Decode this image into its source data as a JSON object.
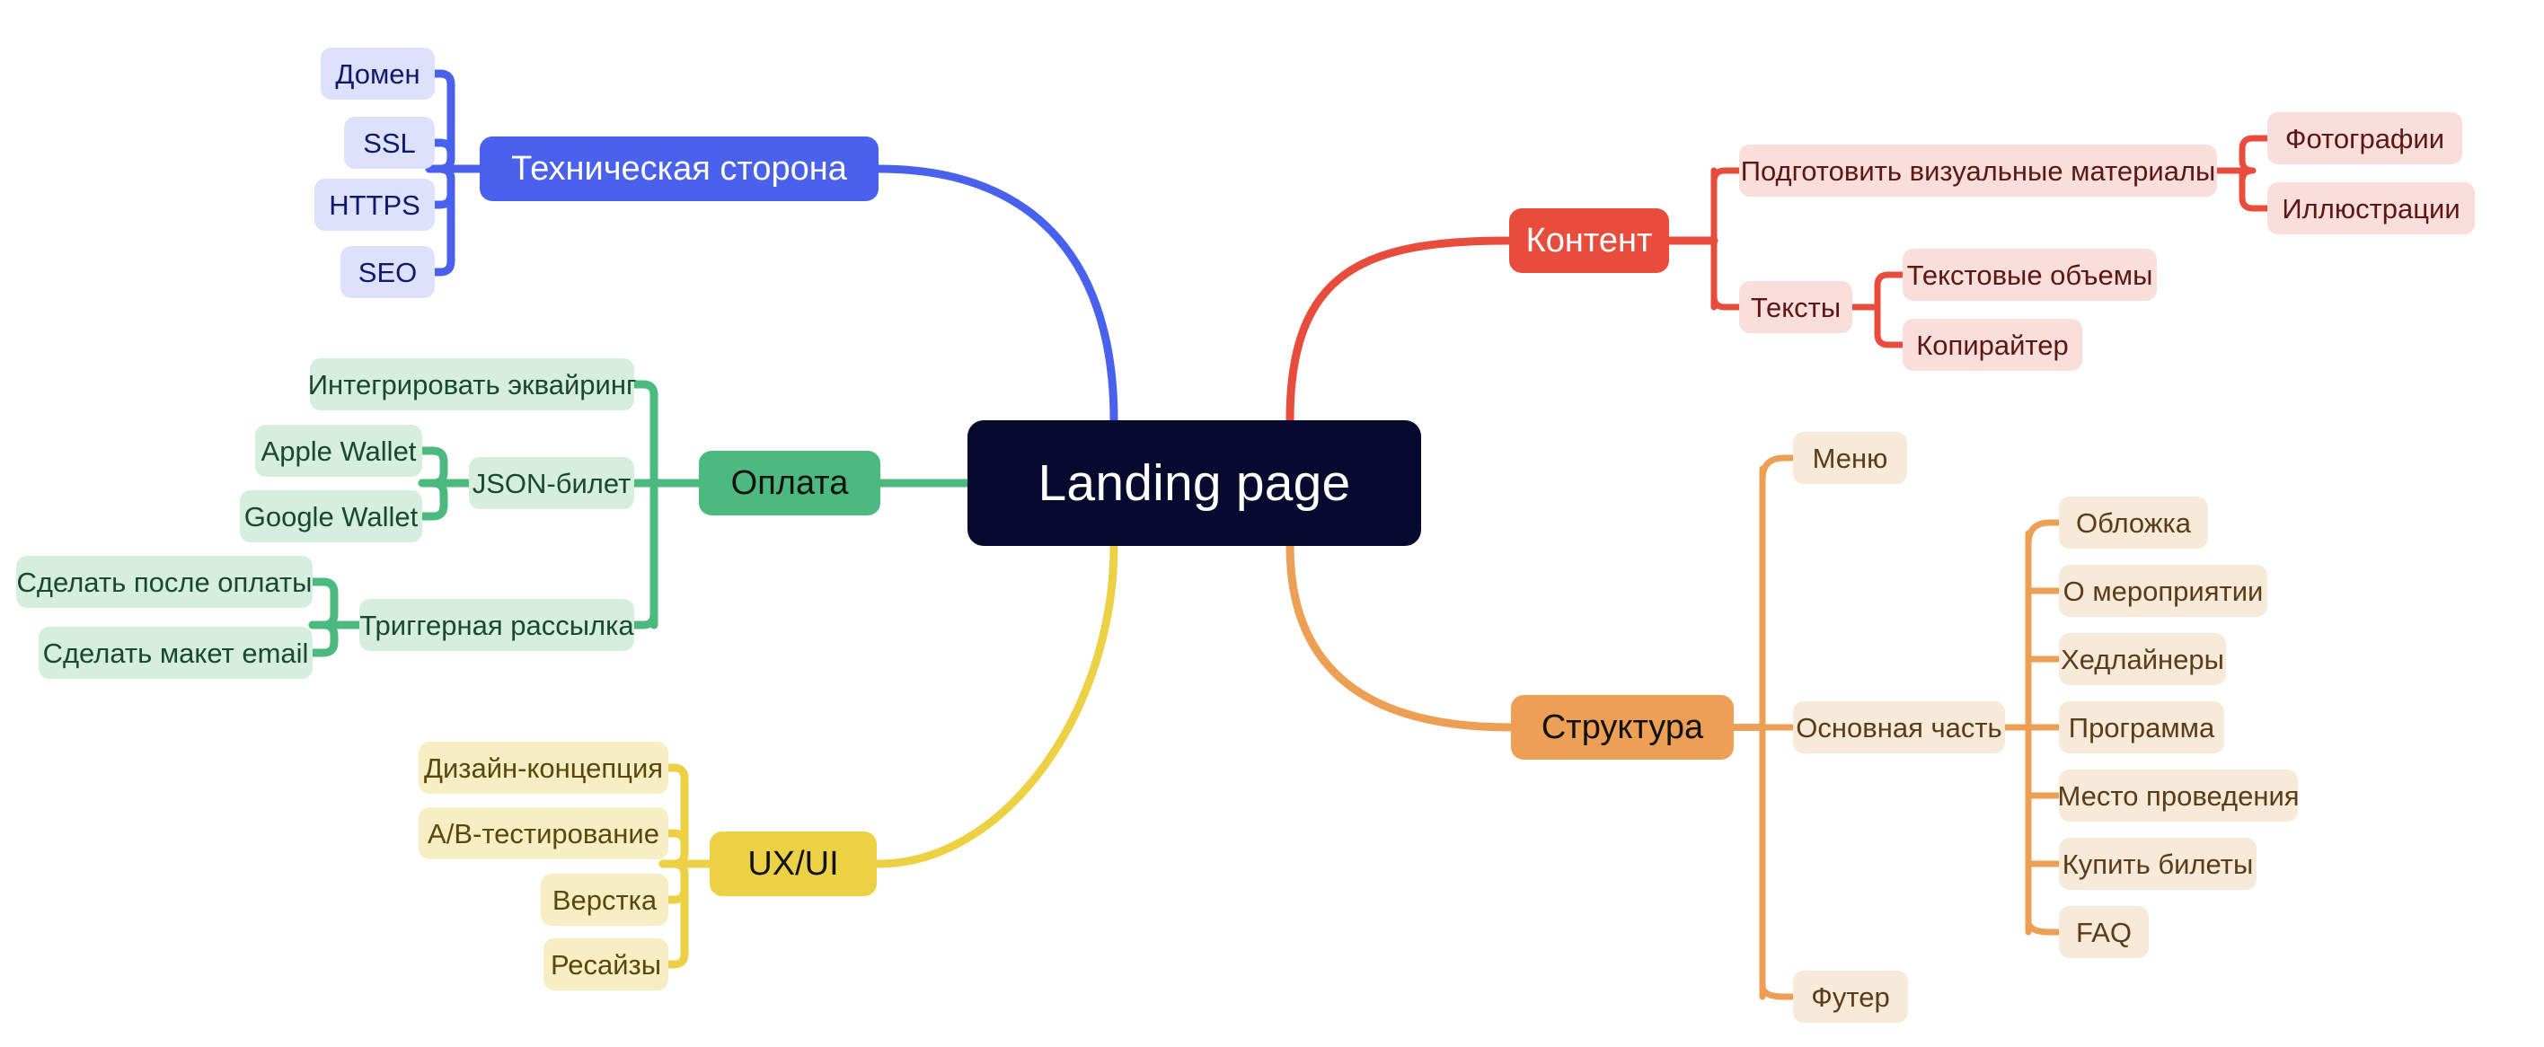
{
  "mindmap": {
    "root": {
      "label": "Landing page",
      "color": "#060a2e"
    },
    "branches": [
      {
        "id": "tech",
        "label": "Техническая сторона",
        "color": "#4a61ed",
        "side": "left",
        "children": [
          {
            "label": "Домен"
          },
          {
            "label": "SSL"
          },
          {
            "label": "HTTPS"
          },
          {
            "label": "SEO"
          }
        ]
      },
      {
        "id": "payment",
        "label": "Оплата",
        "color": "#4cb97e",
        "side": "left",
        "children": [
          {
            "label": "Интегрировать эквайринг"
          },
          {
            "label": "JSON-билет",
            "children": [
              {
                "label": "Apple Wallet"
              },
              {
                "label": "Google Wallet"
              }
            ]
          },
          {
            "label": "Триггерная рассылка",
            "children": [
              {
                "label": "Сделать после оплаты"
              },
              {
                "label": "Сделать макет email"
              }
            ]
          }
        ]
      },
      {
        "id": "uxui",
        "label": "UX/UI",
        "color": "#ecd144",
        "side": "left",
        "children": [
          {
            "label": "Дизайн-концепция"
          },
          {
            "label": "A/B-тестирование"
          },
          {
            "label": "Верстка"
          },
          {
            "label": "Ресайзы"
          }
        ]
      },
      {
        "id": "content",
        "label": "Контент",
        "color": "#e84c3d",
        "side": "right",
        "children": [
          {
            "label": "Подготовить визуальные материалы",
            "children": [
              {
                "label": "Фотографии"
              },
              {
                "label": "Иллюстрации"
              }
            ]
          },
          {
            "label": "Тексты",
            "children": [
              {
                "label": "Текстовые объемы"
              },
              {
                "label": "Копирайтер"
              }
            ]
          }
        ]
      },
      {
        "id": "structure",
        "label": "Структура",
        "color": "#eda055",
        "side": "right",
        "children": [
          {
            "label": "Меню"
          },
          {
            "label": "Основная часть",
            "children": [
              {
                "label": "Обложка"
              },
              {
                "label": "О мероприятии"
              },
              {
                "label": "Хедлайнеры"
              },
              {
                "label": "Программа"
              },
              {
                "label": "Место проведения"
              },
              {
                "label": "Купить билеты"
              },
              {
                "label": "FAQ"
              }
            ]
          },
          {
            "label": "Футер"
          }
        ]
      }
    ]
  }
}
